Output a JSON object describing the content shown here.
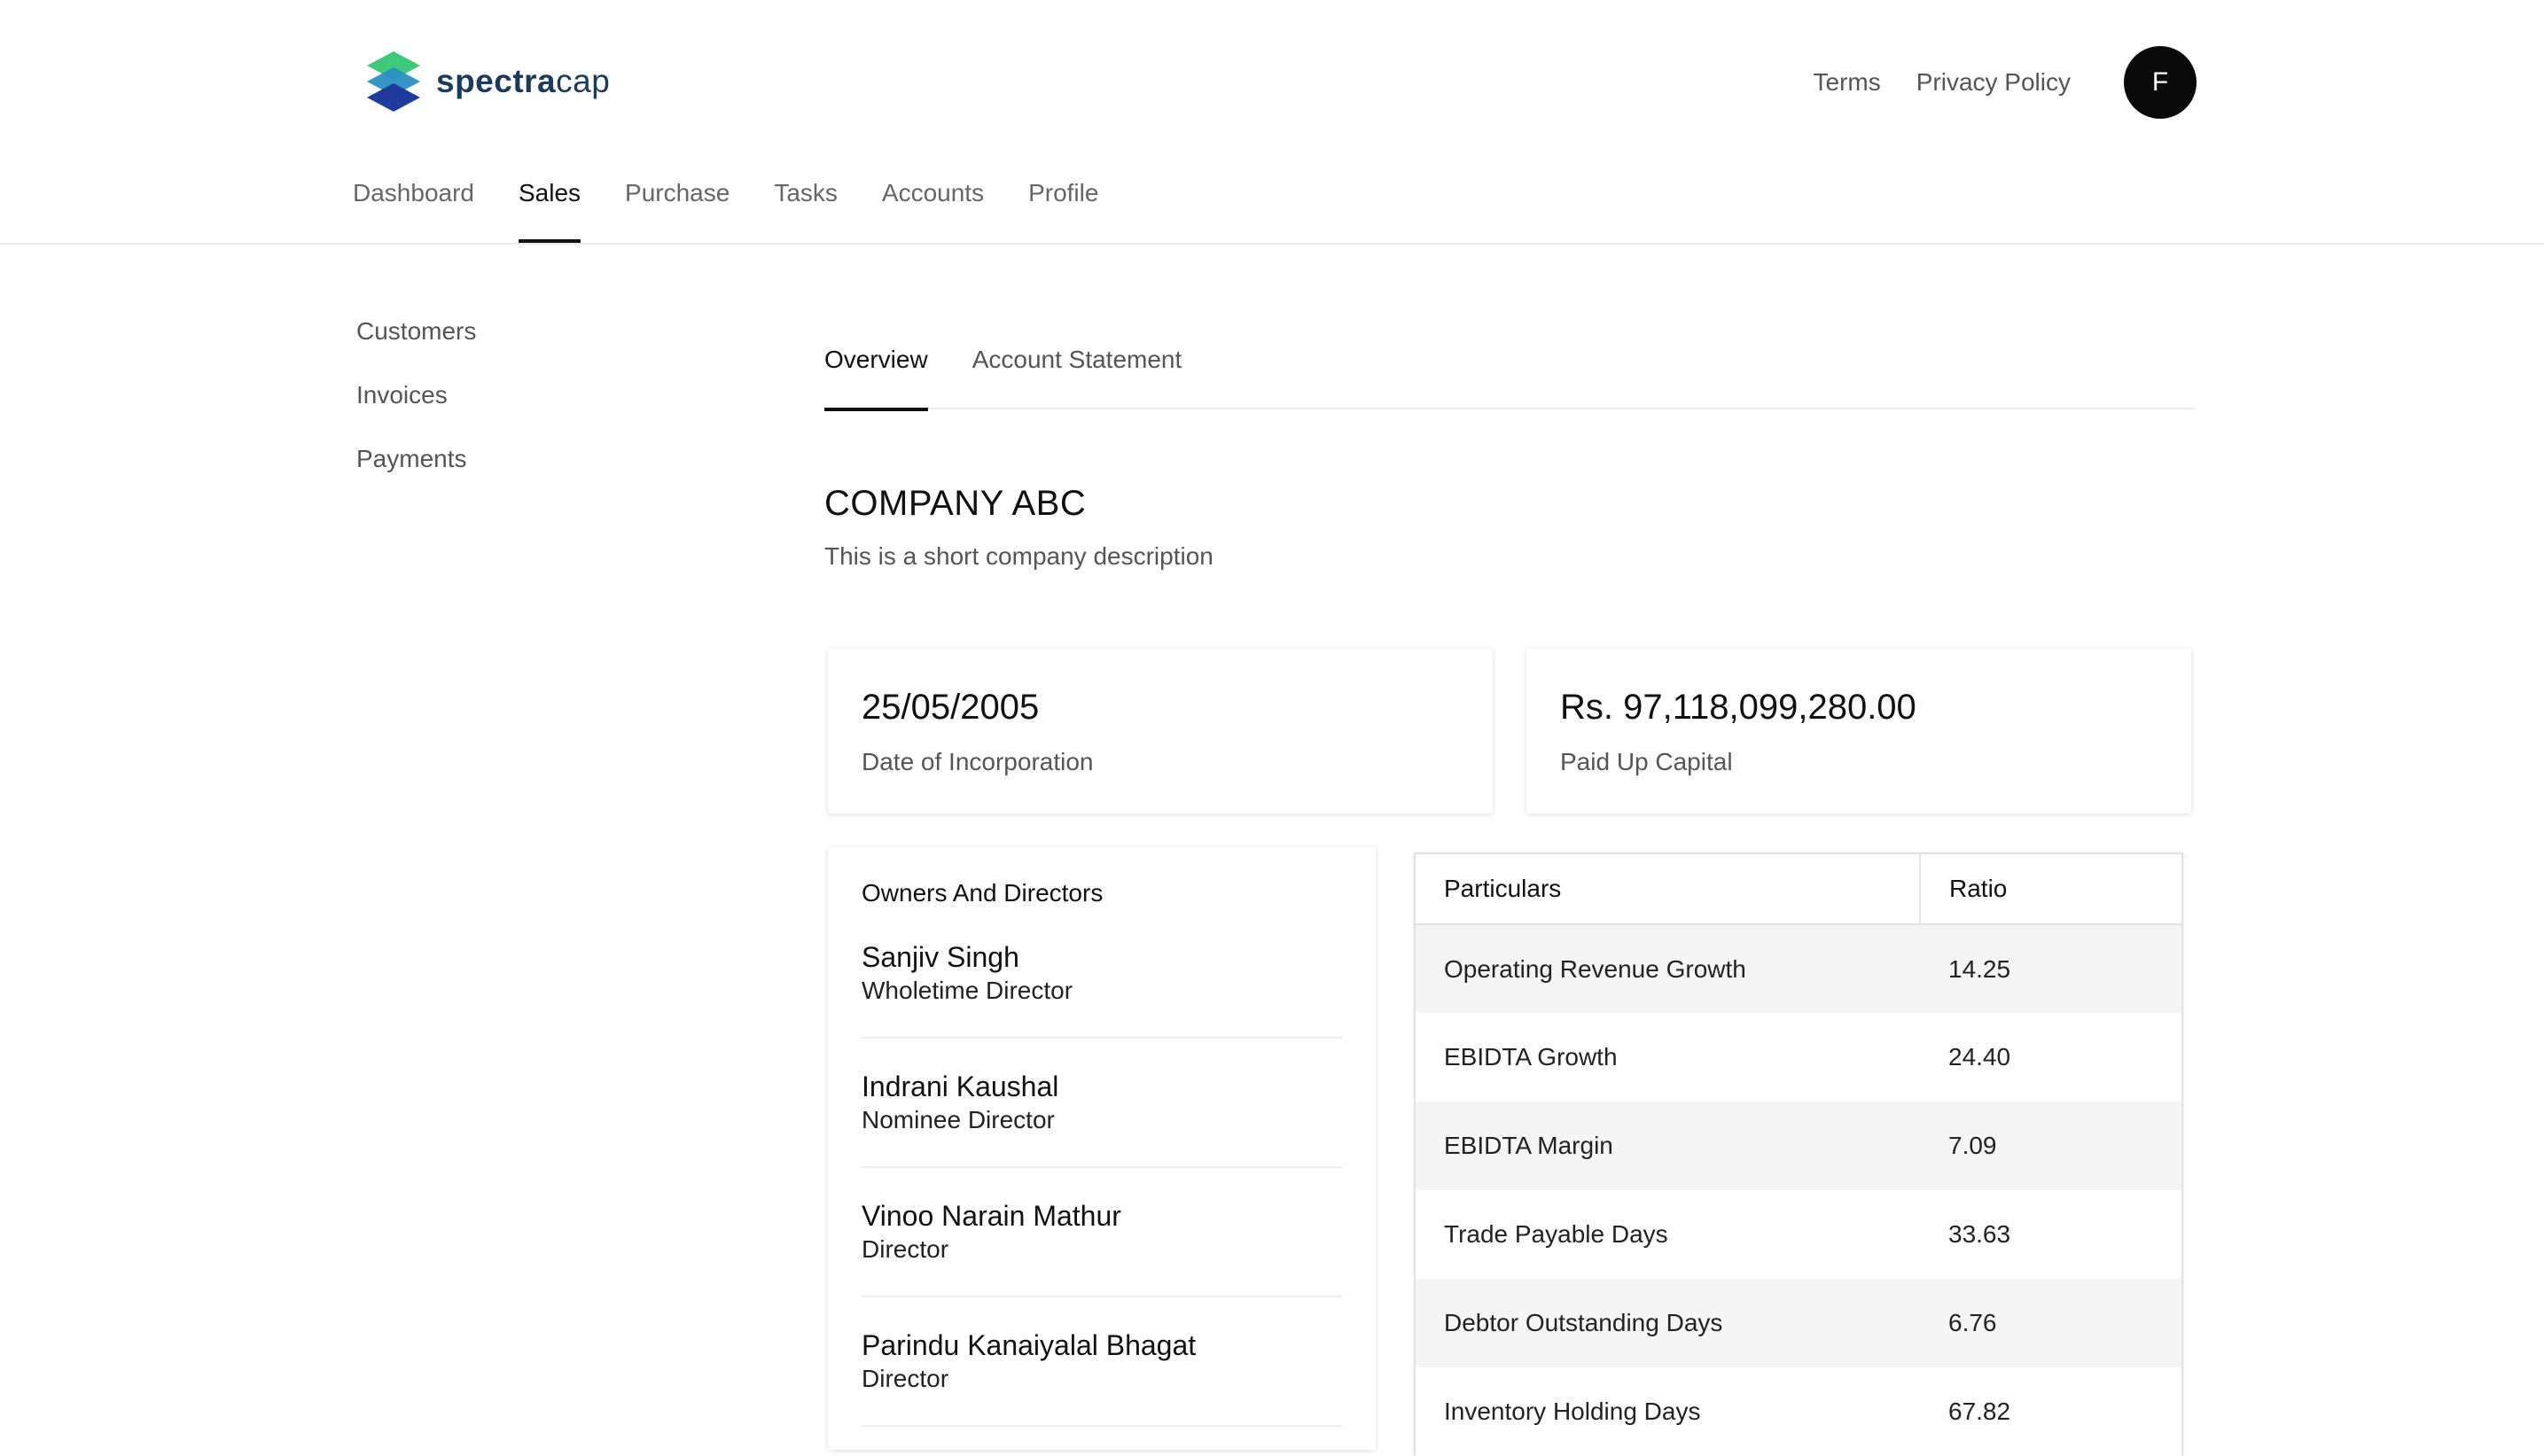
{
  "brand": {
    "name_bold": "spectra",
    "name_regular": "cap"
  },
  "header": {
    "links": [
      "Terms",
      "Privacy Policy"
    ],
    "avatar_initial": "F"
  },
  "main_nav": {
    "items": [
      "Dashboard",
      "Sales",
      "Purchase",
      "Tasks",
      "Accounts",
      "Profile"
    ],
    "active": "Sales"
  },
  "sidebar": {
    "items": [
      "Customers",
      "Invoices",
      "Payments"
    ]
  },
  "tabs": {
    "items": [
      "Overview",
      "Account Statement"
    ],
    "active": "Overview"
  },
  "company": {
    "name": "COMPANY ABC",
    "description": "This is a short company description"
  },
  "stats": [
    {
      "value": "25/05/2005",
      "label": "Date of Incorporation"
    },
    {
      "value": "Rs. 97,118,099,280.00",
      "label": "Paid Up Capital"
    }
  ],
  "owners": {
    "title": "Owners And Directors",
    "items": [
      {
        "name": "Sanjiv Singh",
        "role": "Wholetime Director"
      },
      {
        "name": "Indrani Kaushal",
        "role": "Nominee Director"
      },
      {
        "name": "Vinoo Narain Mathur",
        "role": "Director"
      },
      {
        "name": "Parindu Kanaiyalal Bhagat",
        "role": "Director"
      }
    ]
  },
  "ratios": {
    "headers": [
      "Particulars",
      "Ratio"
    ],
    "rows": [
      {
        "particular": "Operating Revenue Growth",
        "ratio": "14.25"
      },
      {
        "particular": "EBIDTA Growth",
        "ratio": "24.40"
      },
      {
        "particular": "EBIDTA Margin",
        "ratio": "7.09"
      },
      {
        "particular": "Trade Payable Days",
        "ratio": "33.63"
      },
      {
        "particular": "Debtor Outstanding Days",
        "ratio": "6.76"
      },
      {
        "particular": "Inventory Holding Days",
        "ratio": "67.82"
      }
    ]
  },
  "colors": {
    "logo_green": "#3ec97a",
    "logo_teal": "#2a8fc1",
    "logo_blue": "#1e3a9c",
    "brand_text": "#1b3a5c",
    "avatar_bg": "#0a0a0a"
  }
}
